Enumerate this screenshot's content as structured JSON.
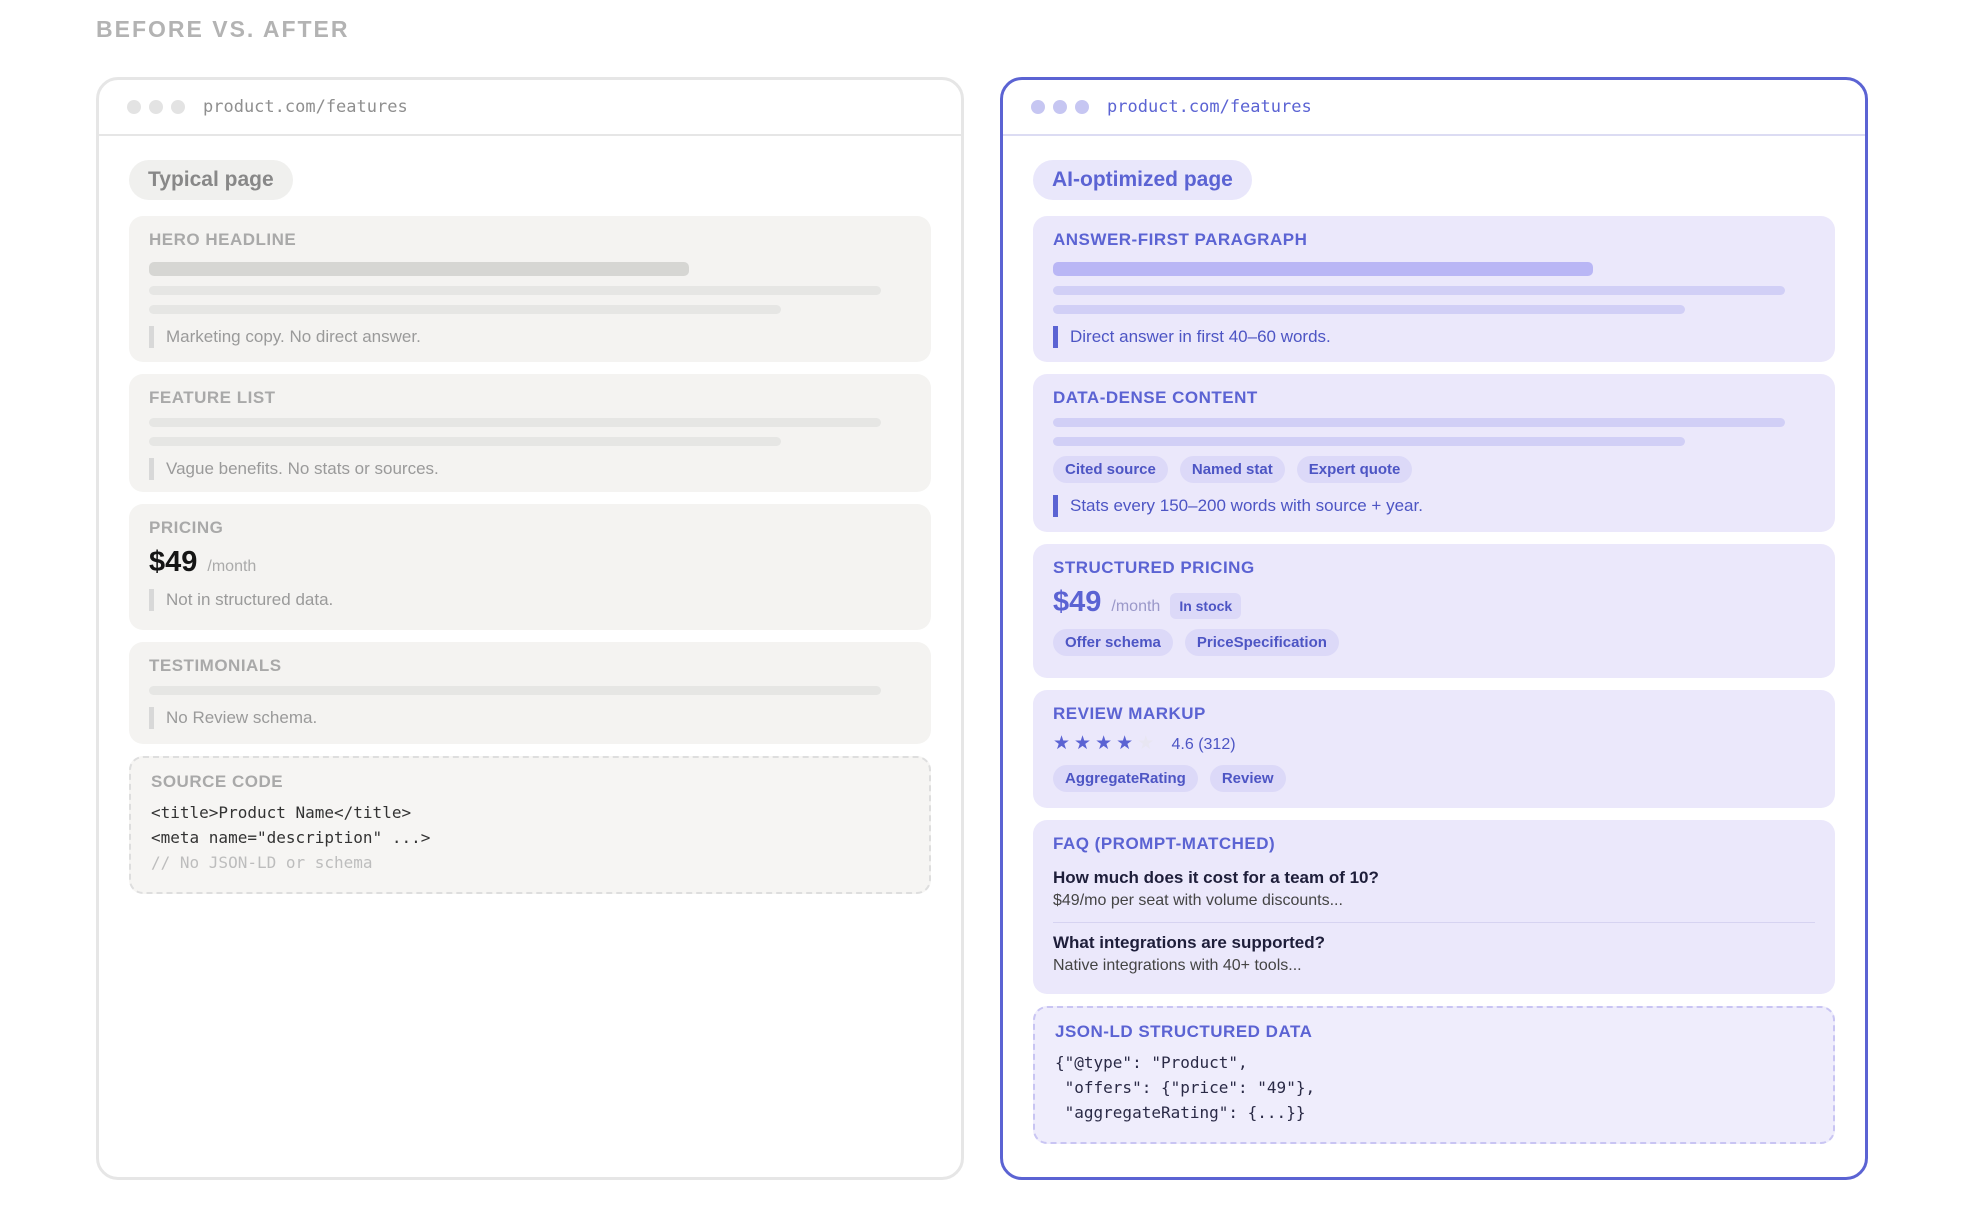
{
  "heading": "BEFORE VS. AFTER",
  "colors": {
    "accent": "#5b63d3",
    "muted": "#b3b3b3"
  },
  "before": {
    "url": "product.com/features",
    "page_label": "Typical page",
    "hero": {
      "title": "HERO HEADLINE",
      "note": "Marketing copy. No direct answer."
    },
    "features": {
      "title": "FEATURE LIST",
      "note": "Vague benefits. No stats or sources."
    },
    "pricing": {
      "title": "PRICING",
      "price": "$49",
      "per": "/month",
      "note": "Not in structured data."
    },
    "testimonials": {
      "title": "TESTIMONIALS",
      "note": "No Review schema."
    },
    "source": {
      "title": "SOURCE CODE",
      "line1": "<title>Product Name</title>",
      "line2": "<meta name=\"description\" ...>",
      "line3": "// No JSON-LD or schema"
    }
  },
  "after": {
    "url": "product.com/features",
    "page_label": "AI-optimized page",
    "answer": {
      "title": "ANSWER-FIRST PARAGRAPH",
      "note": "Direct answer in first 40–60 words."
    },
    "data_dense": {
      "title": "DATA-DENSE CONTENT",
      "tags": [
        "Cited source",
        "Named stat",
        "Expert quote"
      ],
      "note": "Stats every 150–200 words with source + year."
    },
    "pricing": {
      "title": "STRUCTURED PRICING",
      "price": "$49",
      "per": "/month",
      "badge": "In stock",
      "tags": [
        "Offer schema",
        "PriceSpecification"
      ]
    },
    "review": {
      "title": "REVIEW MARKUP",
      "stars_filled": 4,
      "stars_total": 5,
      "rating": "4.6 (312)",
      "tags": [
        "AggregateRating",
        "Review"
      ]
    },
    "faq": {
      "title": "FAQ (PROMPT-MATCHED)",
      "items": [
        {
          "q": "How much does it cost for a team of 10?",
          "a": "$49/mo per seat with volume discounts..."
        },
        {
          "q": "What integrations are supported?",
          "a": "Native integrations with 40+ tools..."
        }
      ]
    },
    "jsonld": {
      "title": "JSON-LD STRUCTURED DATA",
      "line1": "{\"@type\": \"Product\",",
      "line2": " \"offers\": {\"price\": \"49\"},",
      "line3": " \"aggregateRating\": {...}}"
    }
  }
}
